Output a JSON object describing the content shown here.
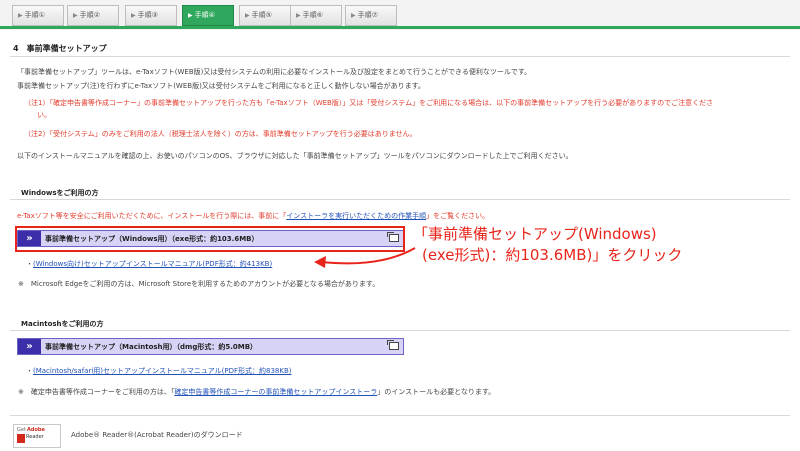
{
  "tabs": [
    "手順①",
    "手順②",
    "手順③",
    "手順④",
    "手順⑤",
    "手順⑥",
    "手順⑦"
  ],
  "tab_arrow": "▶",
  "section_title": "4　事前準備セットアップ",
  "intro1": "「事前準備セットアップ」ツールは、e-Taxソフト(WEB版)又は受付システムの利用に必要なインストール及び設定をまとめて行うことができる便利なツールです。",
  "intro2": "事前準備セットアップ(注)を行わずにe-Taxソフト(WEB版)又は受付システムをご利用になると正しく動作しない場合があります。",
  "note1": "（注1）「確定申告書等作成コーナー」の事前準備セットアップを行った方も「e-Taxソフト（WEB版）」又は「受付システム」をご利用になる場合は、以下の事前準備セットアップを行う必要がありますのでご注意くださ",
  "note1b": "い。",
  "note2": "（注2）「受付システム」のみをご利用の法人（税理士法人を除く）の方は、事前準備セットアップを行う必要はありません。",
  "intro3": "以下のインストールマニュアルを確認の上、お使いのパソコンのOS、ブラウザに対応した「事前準備セットアップ」ツールをパソコンにダウンロードした上でご利用ください。",
  "windows": {
    "heading": "Windowsをご利用の方",
    "warn_pre": "e-Taxソフト等を安全にご利用いただくために、インストールを行う際には、事前に「",
    "warn_link": "インストーラを実行いただくための作業手順",
    "warn_post": "」をご覧ください。",
    "download_label": "事前準備セットアップ（Windows用）（exe形式：約103.6MB）",
    "manual_bullet": "・",
    "manual_link": "(Windows向け)セットアップインストールマニュアル(PDF形式：約413KB)",
    "edge_note": "※　Microsoft Edgeをご利用の方は、Microsoft Storeを利用するためのアカウントが必要となる場合があります。"
  },
  "mac": {
    "heading": "Macintoshをご利用の方",
    "download_label": "事前準備セットアップ（Macintosh用）（dmg形式：約5.0MB）",
    "manual_bullet": "・",
    "manual_link": "(Macintosh/safari用)セットアップインストールマニュアル(PDF形式：約838KB)",
    "note_pre": "※　確定申告書等作成コーナーをご利用の方は、「",
    "note_link": "確定申告書等作成コーナーの事前準備セットアップインストーラ",
    "note_post": "」のインストールも必要となります。"
  },
  "adobe": {
    "get": "Get",
    "brand": "Adobe",
    "reader": "Reader",
    "text": "Adobe® Reader®(Acrobat Reader)のダウンロード"
  },
  "callout": {
    "line1": "「事前準備セットアップ(Windows)",
    "line2": "(exe形式)：約103.6MB)」をクリック"
  },
  "colors": {
    "accent_green": "#2fa85e",
    "annotation_red": "#e8251b",
    "download_bar": "#d7d3f6",
    "arrow_blue": "#3b2ea8"
  }
}
